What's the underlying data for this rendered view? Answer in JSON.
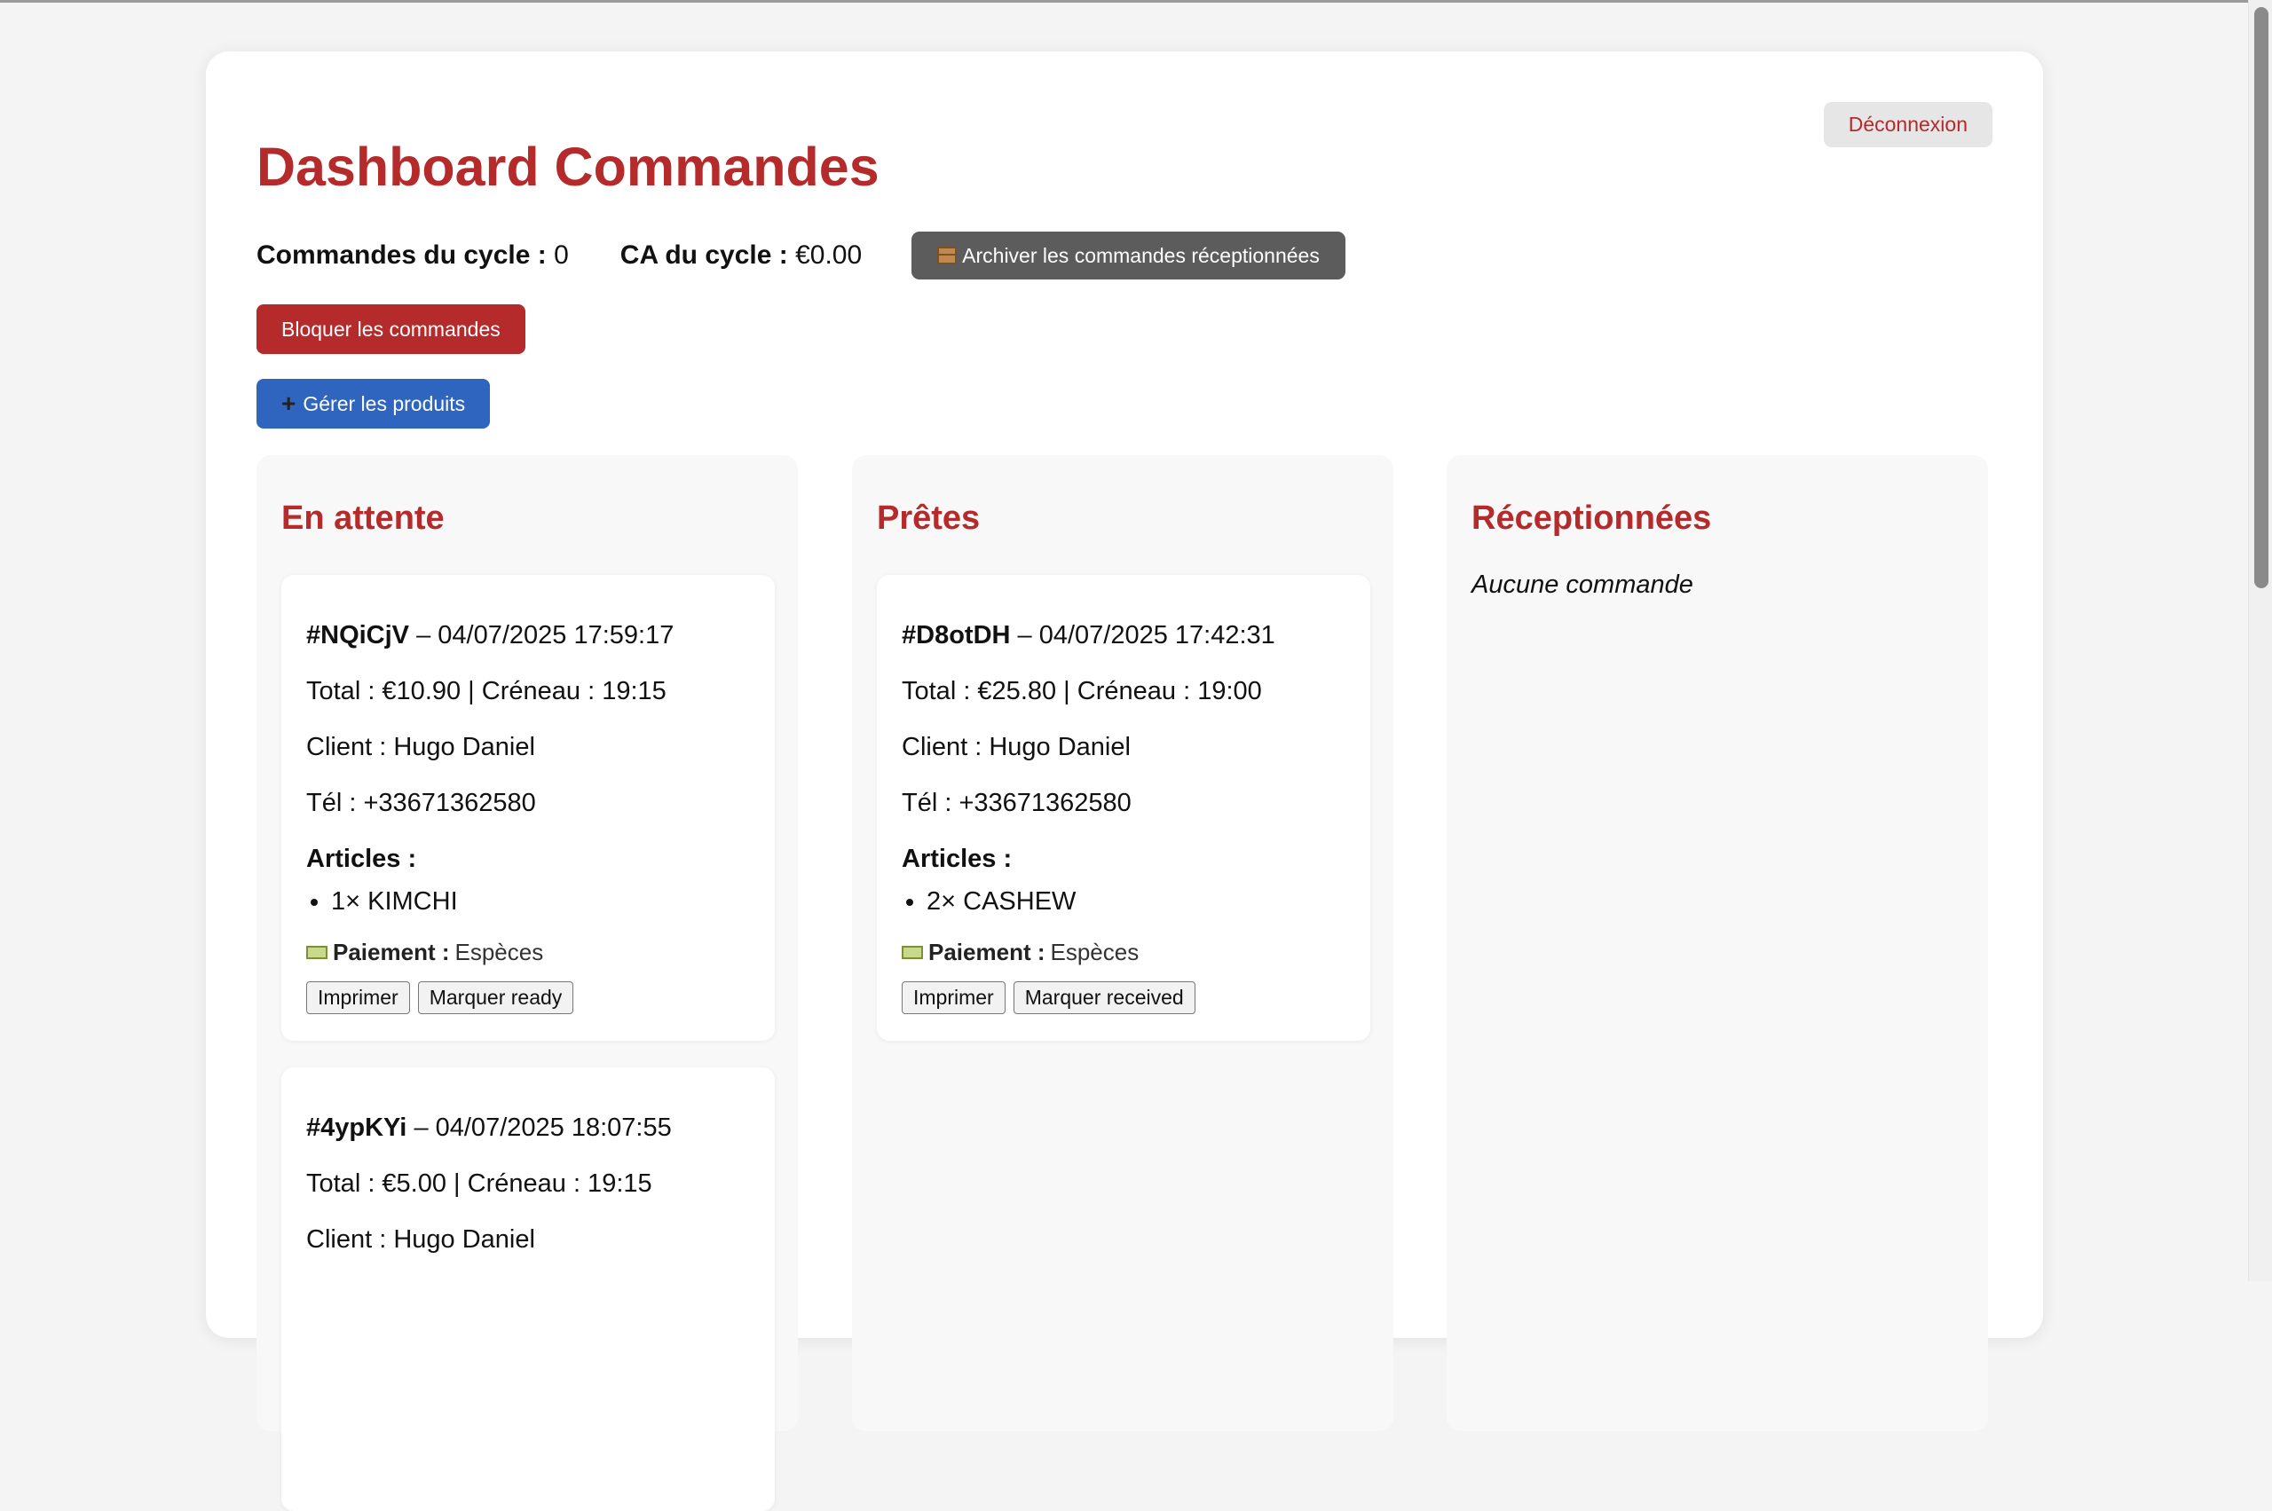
{
  "header": {
    "logout_label": "Déconnexion",
    "title": "Dashboard Commandes"
  },
  "stats": {
    "orders_label": "Commandes du cycle :",
    "orders_value": "0",
    "revenue_label": "CA du cycle :",
    "revenue_value": "€0.00"
  },
  "toolbar": {
    "archive_icon": "package-icon",
    "archive_label": "Archiver les commandes réceptionnées",
    "block_label": "Bloquer les commandes",
    "products_icon": "plus-icon",
    "products_label": "Gérer les produits"
  },
  "columns": {
    "pending": {
      "title": "En attente",
      "orders": [
        {
          "id": "#NQiCjV",
          "datetime": "– 04/07/2025 17:59:17",
          "total_line": "Total : €10.90 | Créneau : 19:15",
          "client_line": "Client : Hugo Daniel",
          "phone_line": "Tél : +33671362580",
          "articles_label": "Articles :",
          "items": [
            "1× KIMCHI"
          ],
          "payment_label": "Paiement :",
          "payment_value": "Espèces",
          "print_label": "Imprimer",
          "action_label": "Marquer ready"
        },
        {
          "id": "#4ypKYi",
          "datetime": "– 04/07/2025 18:07:55",
          "total_line": "Total : €5.00 | Créneau : 19:15",
          "client_line": "Client : Hugo Daniel"
        }
      ]
    },
    "ready": {
      "title": "Prêtes",
      "orders": [
        {
          "id": "#D8otDH",
          "datetime": "– 04/07/2025 17:42:31",
          "total_line": "Total : €25.80 | Créneau : 19:00",
          "client_line": "Client : Hugo Daniel",
          "phone_line": "Tél : +33671362580",
          "articles_label": "Articles :",
          "items": [
            "2× CASHEW"
          ],
          "payment_label": "Paiement :",
          "payment_value": "Espèces",
          "print_label": "Imprimer",
          "action_label": "Marquer received"
        }
      ]
    },
    "received": {
      "title": "Réceptionnées",
      "empty_text": "Aucune commande"
    }
  }
}
